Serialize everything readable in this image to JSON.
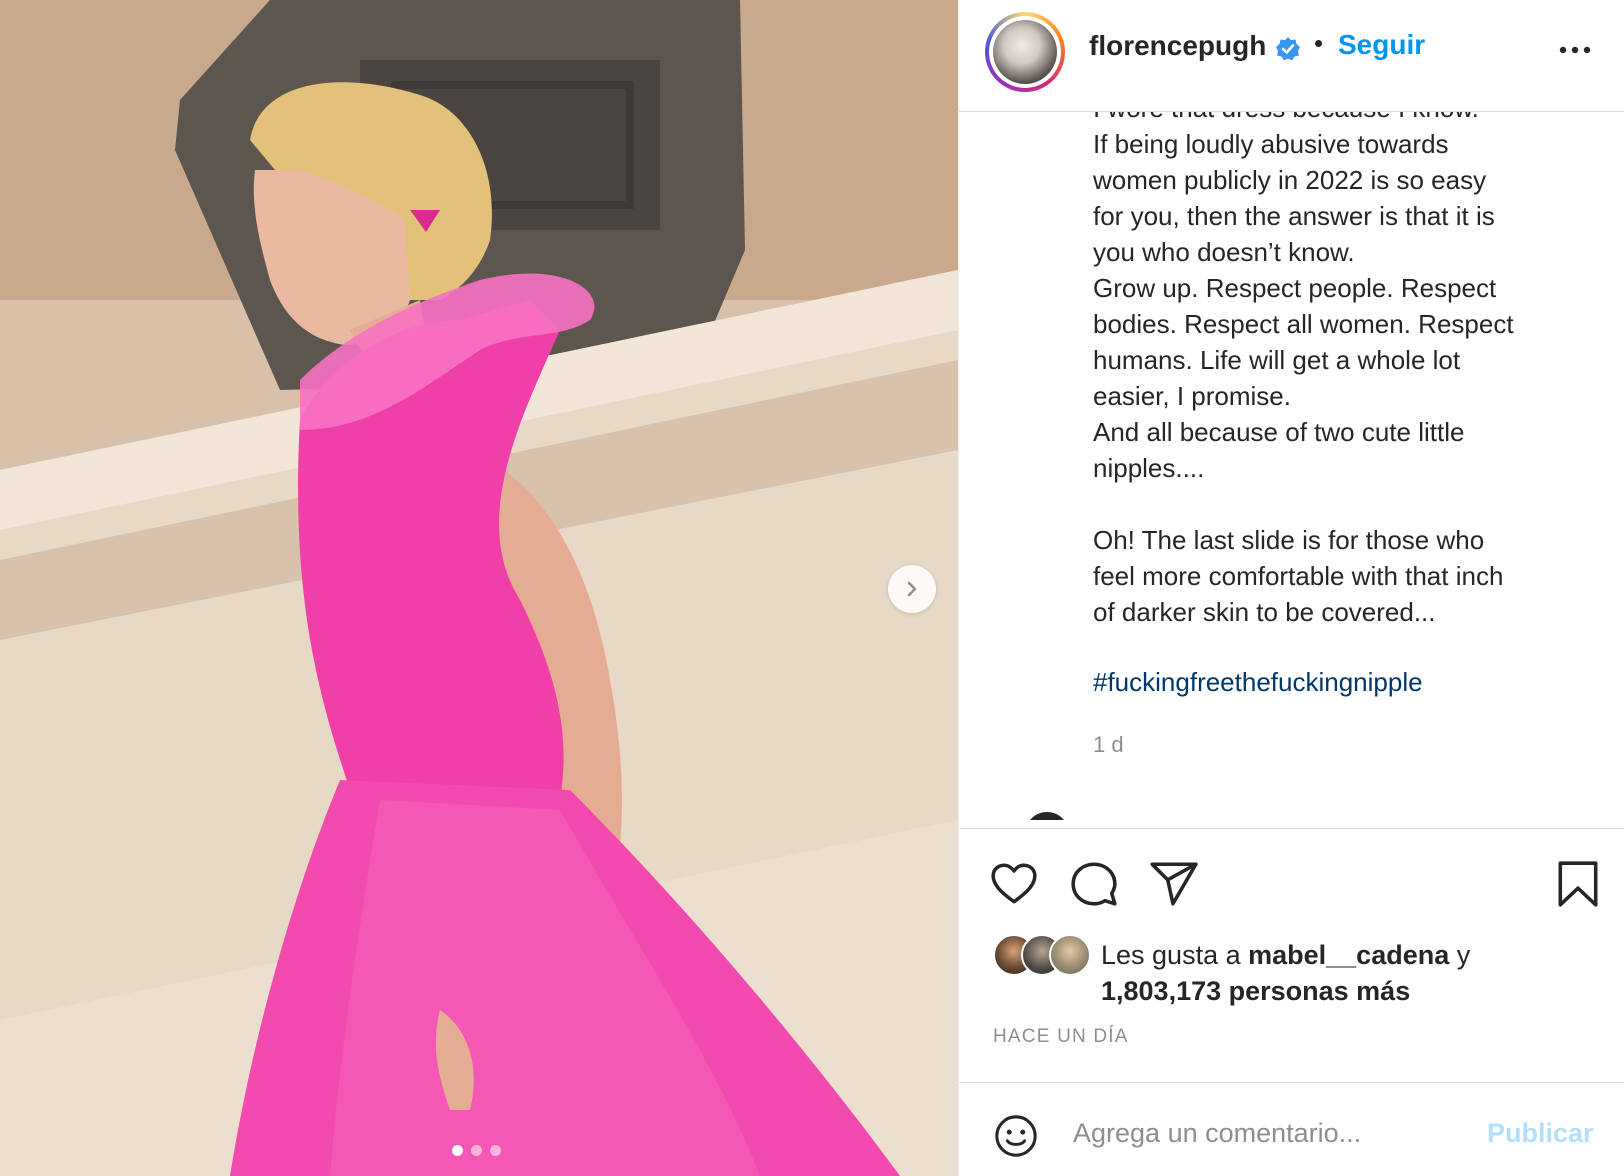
{
  "post": {
    "username": "florencepugh",
    "verified": true,
    "separator": "•",
    "follow_label": "Seguir",
    "caption_partial_top": "I wore that dress because I know.",
    "caption": "If being loudly abusive towards\nwomen publicly in 2022 is so easy\nfor you, then the answer is that it is\nyou who doesn’t know.\nGrow up. Respect people. Respect\nbodies. Respect all women. Respect\nhumans. Life will get a whole lot\neasier, I promise.\nAnd all because of two cute little\nnipples....\n\nOh! The last slide is for those who\nfeel more comfortable with that inch\nof darker skin to be covered...",
    "hashtag": "#fuckingfreethefuckingnipple",
    "time_short": "1 d",
    "likes_prefix": "Les gusta a ",
    "likes_user": "mabel__cadena",
    "likes_suffix": " y",
    "likes_count": "1,803,173 personas más",
    "timestamp": "HACE UN DÍA"
  },
  "carousel": {
    "slide_count": 3,
    "active_slide": 1
  },
  "comment": {
    "placeholder": "Agrega un comentario...",
    "publish_label": "Publicar"
  },
  "icons": [
    "more-options-icon",
    "verified-badge-icon",
    "heart-icon",
    "comment-icon",
    "share-icon",
    "bookmark-icon",
    "emoji-icon",
    "chevron-right-icon"
  ],
  "colors": {
    "accent_blue": "#0095f6",
    "hashtag_blue": "#00376b",
    "muted_text": "#8e8e8e",
    "publish_disabled": "#b2dffc",
    "dress_pink": "#f03aa8"
  }
}
